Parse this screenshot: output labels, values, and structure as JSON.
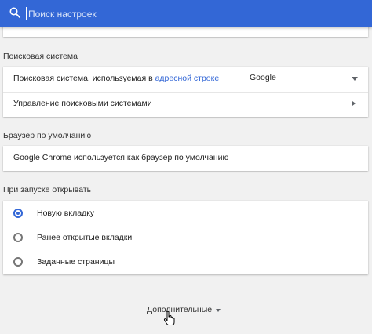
{
  "search": {
    "placeholder": "Поиск настроек"
  },
  "search_engine": {
    "title": "Поисковая система",
    "row_label_prefix": "Поисковая система, используемая в ",
    "row_label_link": "адресной строке",
    "selected": "Google",
    "manage_label": "Управление поисковыми системами"
  },
  "default_browser": {
    "title": "Браузер по умолчанию",
    "status": "Google Chrome используется как браузер по умолчанию"
  },
  "on_startup": {
    "title": "При запуске открывать",
    "options": [
      "Новую вкладку",
      "Ранее открытые вкладки",
      "Заданные страницы"
    ],
    "selected_index": 0
  },
  "advanced_label": "Дополнительные",
  "colors": {
    "header": "#3367d6",
    "accent": "#3367d6",
    "background": "#f1f1f1"
  },
  "icons": [
    "search-icon",
    "caret-down-icon",
    "arrow-right-icon",
    "radio-icon",
    "hand-cursor-icon"
  ]
}
